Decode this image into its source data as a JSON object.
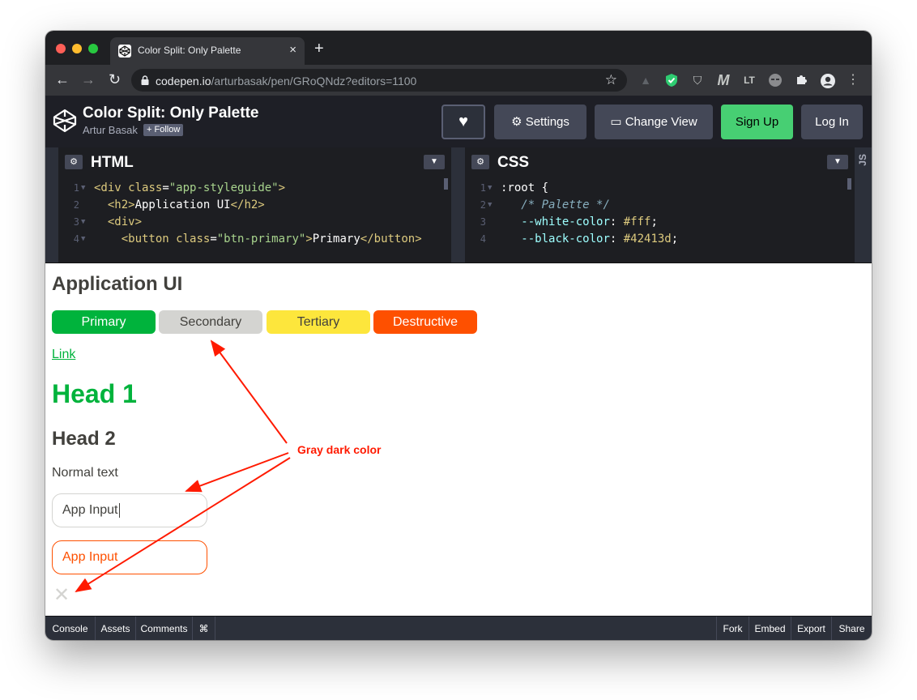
{
  "browser": {
    "tab_title": "Color Split: Only Palette",
    "new_tab": "+",
    "url_host": "codepen.io",
    "url_path": "/arturbasak/pen/GRoQNdz?editors=1100"
  },
  "codepen": {
    "title": "Color Split: Only Palette",
    "author": "Artur Basak",
    "follow_label": "+ Follow",
    "settings_label": "Settings",
    "change_view_label": "Change View",
    "signup_label": "Sign Up",
    "login_label": "Log In"
  },
  "editors": {
    "html_title": "HTML",
    "css_title": "CSS",
    "js_title": "JS",
    "html_lines": [
      {
        "n": "1",
        "pre": "",
        "tag_open": "<div ",
        "attr": "class",
        "eq": "=",
        "str": "\"app-styleguide\"",
        "tag_close": ">",
        "text": "",
        "end": ""
      },
      {
        "n": "2",
        "pre": "  ",
        "tag_open": "<h2>",
        "attr": "",
        "eq": "",
        "str": "",
        "tag_close": "",
        "text": "Application UI",
        "end": "</h2>"
      },
      {
        "n": "3",
        "pre": "  ",
        "tag_open": "<div>",
        "attr": "",
        "eq": "",
        "str": "",
        "tag_close": "",
        "text": "",
        "end": ""
      },
      {
        "n": "4",
        "pre": "    ",
        "tag_open": "<button ",
        "attr": "class",
        "eq": "=",
        "str": "\"btn-primary\"",
        "tag_close": ">",
        "text": "Primary",
        "end": "</button>"
      }
    ],
    "css_lines": [
      {
        "n": "1",
        "pre": "",
        "a": ":root {",
        "b": ""
      },
      {
        "n": "2",
        "pre": "   ",
        "a": "/* Palette */",
        "b": ""
      },
      {
        "n": "3",
        "pre": "   ",
        "a": "--white-color",
        "b": "#fff"
      },
      {
        "n": "4",
        "pre": "   ",
        "a": "--black-color",
        "b": "#42413d"
      }
    ]
  },
  "preview": {
    "heading": "Application UI",
    "buttons": [
      "Primary",
      "Secondary",
      "Tertiary",
      "Destructive"
    ],
    "link": "Link",
    "head1": "Head 1",
    "head2": "Head 2",
    "normal_text": "Normal text",
    "input1_value": "App Input",
    "input2_value": "App Input",
    "close_glyph": "✕"
  },
  "annotation": {
    "label": "Gray dark color",
    "color": "#ff1a00"
  },
  "footer": {
    "left": [
      "Console",
      "Assets",
      "Comments",
      "⌘"
    ],
    "right": [
      "Fork",
      "Embed",
      "Export",
      "Share"
    ]
  },
  "colors": {
    "primary": "#00b33c",
    "secondary": "#d4d4d1",
    "tertiary": "#fde63c",
    "destructive": "#fe5000",
    "text": "#42413d"
  }
}
